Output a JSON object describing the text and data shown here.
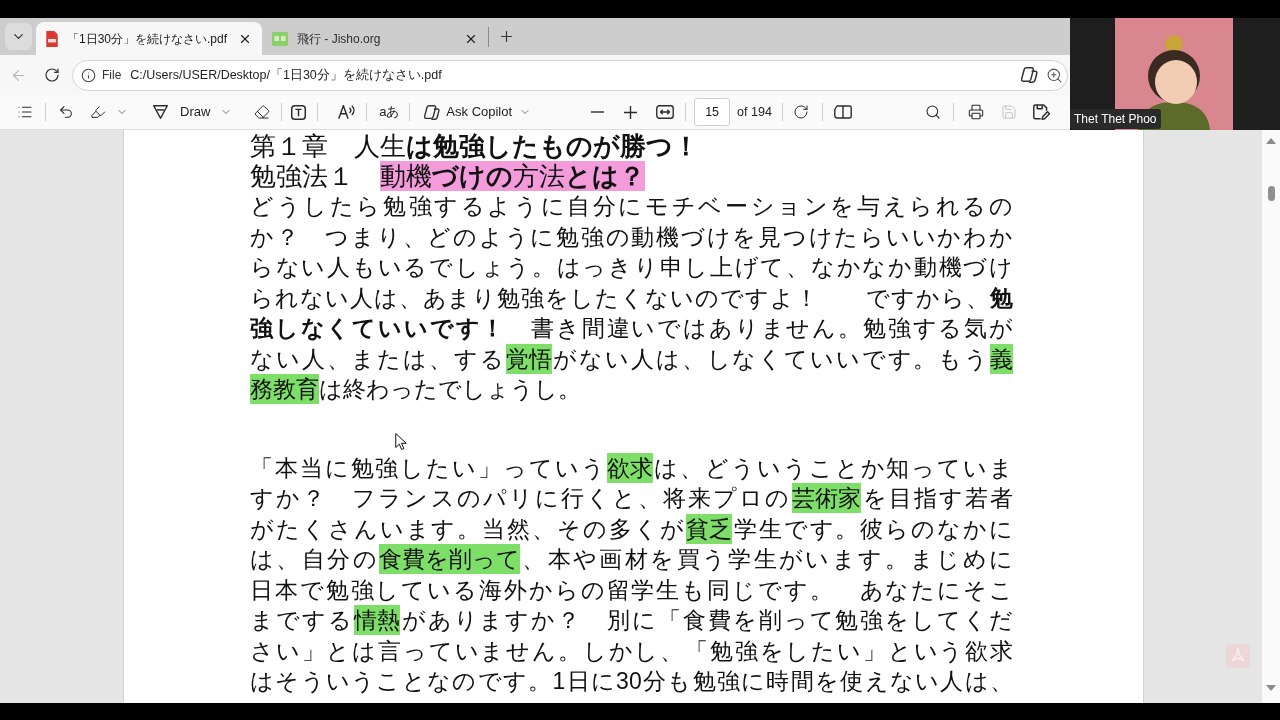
{
  "browser": {
    "tabs": [
      {
        "kind": "pdf",
        "title": "「1日30分」を続けなさい.pdf",
        "selected": true
      },
      {
        "kind": "web",
        "title": "飛行 - Jisho.org",
        "selected": false
      }
    ],
    "back_button": {
      "disabled": true
    },
    "address_bar": {
      "scheme": "File",
      "url": "C:/Users/USER/Desktop/「1日30分」を続けなさい.pdf"
    }
  },
  "pdf_toolbar": {
    "draw_label": "Draw",
    "translate_label": "aあ",
    "copilot_label": "Ask Copilot",
    "page_field": {
      "value": "15"
    },
    "page_total": "of 194",
    "save_button": {
      "disabled": true
    }
  },
  "document": {
    "blocks": [
      {
        "kind": "heading",
        "lines": [
          {
            "segments": [
              {
                "text": "第１章　人生**は勉強したものが勝つ！**"
              }
            ]
          },
          {
            "segments": [
              {
                "text": "勉強法１　"
              },
              {
                "text": "動機**づけの**方法**とは？**",
                "color": "#f49cdb"
              }
            ]
          }
        ]
      },
      {
        "kind": "paragraph",
        "continues": false,
        "lines": [
          {
            "segments": [
              {
                "text": "どうしたら勉強するように自分にモチベーションを与えられるの"
              }
            ]
          },
          {
            "segments": [
              {
                "text": "か？　つまり、どのように勉強の動機づけを見つけたらいいかわか"
              }
            ]
          },
          {
            "segments": [
              {
                "text": "らない人もいるでしょう。はっきり申し上げて、なかなか動機づけ"
              }
            ]
          },
          {
            "segments": [
              {
                "text": "られない人は、あまり勉強をしたくないのですよ！　　ですから、**勉**"
              }
            ]
          },
          {
            "segments": [
              {
                "text": "**強しなくていいです！**　書き間違いではありません。勉強する気が"
              }
            ]
          },
          {
            "segments": [
              {
                "text": "ない人、または、する"
              },
              {
                "text": "覚悟",
                "color": "#7edf68"
              },
              {
                "text": "がない人は、しなくていいです。もう"
              },
              {
                "text": "義",
                "color": "#7edf68"
              }
            ]
          },
          {
            "segments": [
              {
                "text": "務教育",
                "color": "#7edf68"
              },
              {
                "text": "は終わったでしょうし。"
              }
            ]
          }
        ]
      },
      {
        "kind": "paragraph",
        "continues": true,
        "lines": [
          {
            "segments": [
              {
                "text": "「本当に勉強したい」っていう"
              },
              {
                "text": "欲求",
                "color": "#7edf68"
              },
              {
                "text": "は、どういうことか知っていま"
              }
            ]
          },
          {
            "segments": [
              {
                "text": "すか？　フランスのパリに行くと、将来プロの"
              },
              {
                "text": "芸術家",
                "color": "#7edf68"
              },
              {
                "text": "を目指す若者"
              }
            ]
          },
          {
            "segments": [
              {
                "text": "がたくさんいます。当然、その多くが"
              },
              {
                "text": "貧乏",
                "color": "#7edf68"
              },
              {
                "text": "学生です。彼らのなかに"
              }
            ]
          },
          {
            "segments": [
              {
                "text": "は、自分の"
              },
              {
                "text": "食費を削って",
                "color": "#7edf68"
              },
              {
                "text": "、本や画材を買う学生がいます。まじめに"
              }
            ]
          },
          {
            "segments": [
              {
                "text": "日本で勉強している海外からの留学生も同じです。　あなたにそこ"
              }
            ]
          },
          {
            "segments": [
              {
                "text": "までする"
              },
              {
                "text": "情熱",
                "color": "#7edf68"
              },
              {
                "text": "がありますか？　別に「食費を削って勉強をしてくだ"
              }
            ]
          },
          {
            "segments": [
              {
                "text": "さい」とは言っていません。しかし、「勉強をしたい」という欲求"
              }
            ]
          },
          {
            "segments": [
              {
                "text": "はそういうことなのです。1日に30分も勉強に時間を使えない人は、"
              }
            ]
          }
        ]
      }
    ]
  },
  "video_tile": {
    "name": "Thet Thet Phoo"
  }
}
